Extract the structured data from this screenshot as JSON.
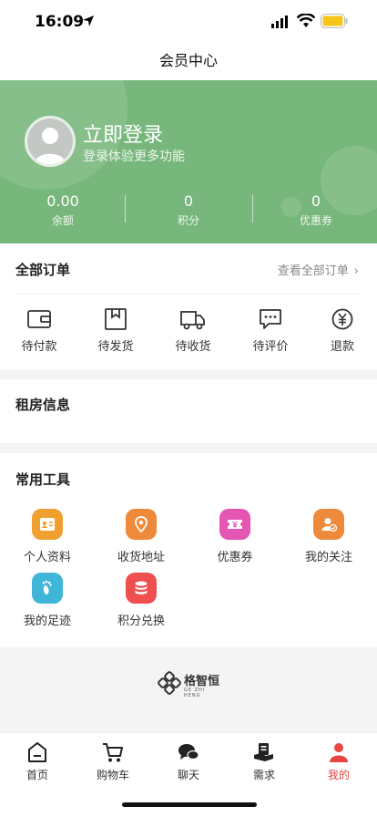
{
  "status": {
    "time": "16:09"
  },
  "nav": {
    "title": "会员中心"
  },
  "profile": {
    "login_title": "立即登录",
    "login_subtitle": "登录体验更多功能",
    "stats": [
      {
        "value": "0.00",
        "label": "余额"
      },
      {
        "value": "0",
        "label": "积分"
      },
      {
        "value": "0",
        "label": "优惠券"
      }
    ]
  },
  "orders": {
    "title": "全部订单",
    "view_all": "查看全部订单",
    "items": [
      {
        "label": "待付款",
        "icon": "wallet-icon"
      },
      {
        "label": "待发货",
        "icon": "package-icon"
      },
      {
        "label": "待收货",
        "icon": "truck-icon"
      },
      {
        "label": "待评价",
        "icon": "comment-icon"
      },
      {
        "label": "退款",
        "icon": "refund-icon"
      }
    ]
  },
  "rental": {
    "title": "租房信息"
  },
  "tools": {
    "title": "常用工具",
    "items": [
      {
        "label": "个人资料",
        "icon": "profile-card-icon",
        "color": "#f0a030"
      },
      {
        "label": "收货地址",
        "icon": "location-pin-icon",
        "color": "#ef8a3a"
      },
      {
        "label": "优惠券",
        "icon": "coupon-icon",
        "color": "#e455b4"
      },
      {
        "label": "我的关注",
        "icon": "follow-user-icon",
        "color": "#ee8a3c"
      },
      {
        "label": "我的足迹",
        "icon": "footprint-icon",
        "color": "#3fb6d8"
      },
      {
        "label": "积分兑换",
        "icon": "points-coins-icon",
        "color": "#ee5050"
      }
    ]
  },
  "brand": {
    "name": "格智恒",
    "sub": "GE ZHI HENG"
  },
  "tabbar": {
    "items": [
      {
        "label": "首页",
        "icon": "home-icon"
      },
      {
        "label": "购物车",
        "icon": "cart-icon"
      },
      {
        "label": "聊天",
        "icon": "chat-icon"
      },
      {
        "label": "需求",
        "icon": "demand-icon"
      },
      {
        "label": "我的",
        "icon": "user-icon"
      }
    ],
    "active_index": 4
  },
  "colors": {
    "header_green": "#77b77b",
    "active_tab": "#e84545"
  }
}
